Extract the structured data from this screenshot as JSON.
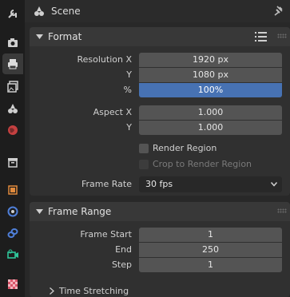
{
  "header": {
    "title": "Scene",
    "pin_icon": "pin-icon"
  },
  "tabs": [
    {
      "name": "tool-tab",
      "icon": "tool-icon"
    },
    {
      "name": "render-tab",
      "icon": "camera-back-icon"
    },
    {
      "name": "output-tab",
      "icon": "printer-icon",
      "active": true
    },
    {
      "name": "view-layer-tab",
      "icon": "image-stack-icon"
    },
    {
      "name": "scene-tab",
      "icon": "scene-icon"
    },
    {
      "name": "world-tab",
      "icon": "world-icon"
    },
    {
      "name": "collection-tab",
      "icon": "box-icon"
    },
    {
      "name": "object-tab",
      "icon": "object-icon"
    },
    {
      "name": "physics-tab",
      "icon": "physics-icon"
    },
    {
      "name": "constraints-tab",
      "icon": "constraint-icon"
    },
    {
      "name": "data-tab",
      "icon": "camera-data-icon"
    },
    {
      "name": "texture-tab",
      "icon": "checker-icon"
    }
  ],
  "format": {
    "title": "Format",
    "resolution_x_label": "Resolution X",
    "resolution_x": "1920 px",
    "y_label": "Y",
    "resolution_y": "1080 px",
    "percent_label": "%",
    "percent": "100%",
    "aspect_x_label": "Aspect X",
    "aspect_x": "1.000",
    "aspect_y_label": "Y",
    "aspect_y": "1.000",
    "render_region": "Render Region",
    "crop_region": "Crop to Render Region",
    "frame_rate_label": "Frame Rate",
    "frame_rate": "30 fps"
  },
  "frame_range": {
    "title": "Frame Range",
    "start_label": "Frame Start",
    "start": "1",
    "end_label": "End",
    "end": "250",
    "step_label": "Step",
    "step": "1",
    "time_stretching": "Time Stretching"
  },
  "colors": {
    "accent": "#4772b3",
    "background": "#282828",
    "field": "#545454"
  }
}
